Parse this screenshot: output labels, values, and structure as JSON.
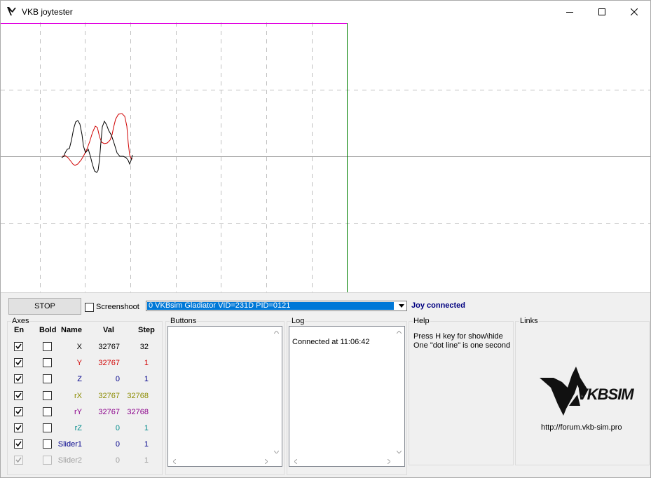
{
  "window": {
    "title": "VKB joytester"
  },
  "toolbar": {
    "stop_label": "STOP",
    "screenshoot_label": "Screenshoot",
    "device": "0 VKBsim Gladiator  VID=231D PID=0121",
    "status": "Joy connected",
    "status_color": "#000080"
  },
  "axes": {
    "title": "Axes",
    "headers": {
      "en": "En",
      "bold": "Bold",
      "name": "Name",
      "val": "Val",
      "step": "Step"
    },
    "rows": [
      {
        "name": "X",
        "val": "32767",
        "step": "32",
        "color": "#000000",
        "enabled": true
      },
      {
        "name": "Y",
        "val": "32767",
        "step": "1",
        "color": "#d00000",
        "enabled": true
      },
      {
        "name": "Z",
        "val": "0",
        "step": "1",
        "color": "#00008b",
        "enabled": true
      },
      {
        "name": "rX",
        "val": "32767",
        "step": "32768",
        "color": "#8b8b00",
        "enabled": true
      },
      {
        "name": "rY",
        "val": "32767",
        "step": "32768",
        "color": "#8b008b",
        "enabled": true
      },
      {
        "name": "rZ",
        "val": "0",
        "step": "1",
        "color": "#008b8b",
        "enabled": true
      },
      {
        "name": "Slider1",
        "val": "0",
        "step": "1",
        "color": "#00008b",
        "enabled": true
      },
      {
        "name": "Slider2",
        "val": "0",
        "step": "1",
        "color": "#a0a0a0",
        "enabled": false
      }
    ]
  },
  "buttons_group": {
    "title": "Buttons"
  },
  "log_group": {
    "title": "Log",
    "lines": [
      "Connected at 11:06:42"
    ]
  },
  "help_group": {
    "title": "Help",
    "line1": "Press H key for show\\hide",
    "line2": "One \"dot line\" is one second"
  },
  "links_group": {
    "title": "Links",
    "logo_text": "VKBSIM",
    "url": "http://forum.vkb-sim.pro"
  },
  "colors": {
    "trace_x": "#000000",
    "trace_y": "#d00000",
    "top_line": "#e000e0",
    "cursor_line": "#008000"
  }
}
